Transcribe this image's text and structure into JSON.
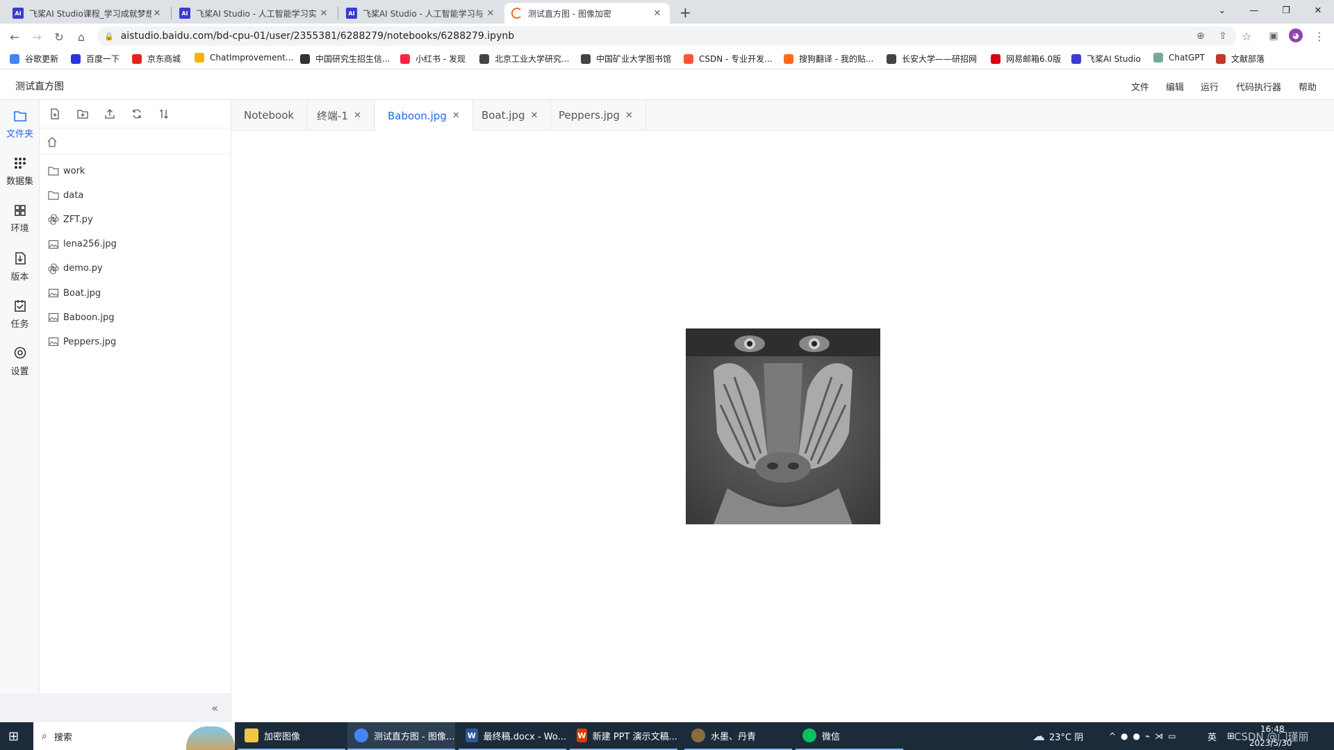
{
  "browser": {
    "tabs": [
      {
        "title": "飞桨AI Studio课程_学习成就梦想",
        "active": false
      },
      {
        "title": "飞桨AI Studio - 人工智能学习实",
        "active": false
      },
      {
        "title": "飞桨AI Studio - 人工智能学习与",
        "active": false
      },
      {
        "title": "测试直方图 - 图像加密",
        "active": true
      }
    ],
    "new_tab": "+",
    "url": "aistudio.baidu.com/bd-cpu-01/user/2355381/6288279/notebooks/6288279.ipynb",
    "bookmarks": [
      {
        "label": "谷歌更新",
        "color": "#4285f4"
      },
      {
        "label": "百度一下",
        "color": "#2932e1"
      },
      {
        "label": "京东商城",
        "color": "#e1251b"
      },
      {
        "label": "ChatImprovement...",
        "color": "#f4b400"
      },
      {
        "label": "中国研究生招生信...",
        "color": "#333333"
      },
      {
        "label": "小红书 - 发现",
        "color": "#ff2442"
      },
      {
        "label": "北京工业大学研究...",
        "color": "#444444"
      },
      {
        "label": "中国矿业大学图书馆",
        "color": "#444444"
      },
      {
        "label": "CSDN - 专业开发...",
        "color": "#fc5531"
      },
      {
        "label": "搜狗翻译 - 我的贴...",
        "color": "#fb6b1d"
      },
      {
        "label": "长安大学——研招网",
        "color": "#444444"
      },
      {
        "label": "网易邮箱6.0版",
        "color": "#d7000f"
      },
      {
        "label": "飞桨AI Studio",
        "color": "#3b3bd1"
      },
      {
        "label": "ChatGPT",
        "color": "#74aa9c"
      },
      {
        "label": "文献部落",
        "color": "#c0392b"
      }
    ]
  },
  "app": {
    "title": "测试直方图",
    "menu": [
      "文件",
      "编辑",
      "运行",
      "代码执行器",
      "帮助"
    ]
  },
  "left_nav": [
    {
      "label": "文件夹",
      "icon": "folder-icon",
      "active": true
    },
    {
      "label": "数据集",
      "icon": "dataset-icon",
      "active": false
    },
    {
      "label": "环境",
      "icon": "environment-icon",
      "active": false
    },
    {
      "label": "版本",
      "icon": "version-icon",
      "active": false
    },
    {
      "label": "任务",
      "icon": "task-icon",
      "active": false
    },
    {
      "label": "设置",
      "icon": "settings-icon",
      "active": false
    }
  ],
  "files": [
    {
      "name": "work",
      "type": "folder"
    },
    {
      "name": "data",
      "type": "folder"
    },
    {
      "name": "ZFT.py",
      "type": "python"
    },
    {
      "name": "lena256.jpg",
      "type": "image"
    },
    {
      "name": "demo.py",
      "type": "python"
    },
    {
      "name": "Boat.jpg",
      "type": "image"
    },
    {
      "name": "Baboon.jpg",
      "type": "image"
    },
    {
      "name": "Peppers.jpg",
      "type": "image"
    }
  ],
  "editor_tabs": [
    {
      "label": "Notebook",
      "closable": false,
      "active": false
    },
    {
      "label": "终端-1",
      "closable": true,
      "active": false
    },
    {
      "label": "Baboon.jpg",
      "closable": true,
      "active": true
    },
    {
      "label": "Boat.jpg",
      "closable": true,
      "active": false
    },
    {
      "label": "Peppers.jpg",
      "closable": true,
      "active": false
    }
  ],
  "taskbar": {
    "search": "搜索",
    "apps": [
      {
        "label": "加密图像",
        "color": "#f4c542"
      },
      {
        "label": "测试直方图 - 图像...",
        "color": "#4285f4"
      },
      {
        "label": "最终稿.docx - Wo...",
        "color": "#2b579a"
      },
      {
        "label": "新建 PPT 演示文稿...",
        "color": "#d83b01"
      },
      {
        "label": "水墨、丹青",
        "color": "#8a6d3b"
      },
      {
        "label": "微信",
        "color": "#07c160"
      }
    ],
    "weather": "23°C 阴",
    "ime": "英",
    "time": "16:48",
    "date": "2023/5/30",
    "watermark": "CSDN @门瑾丽"
  },
  "colors": {
    "accent": "#2468f2",
    "taskbar": "#1c2b3a"
  }
}
